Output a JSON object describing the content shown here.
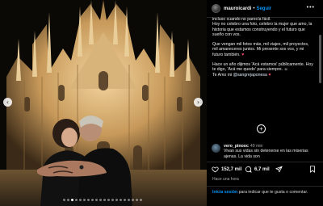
{
  "post": {
    "username": "mauroicardi",
    "separator": "•",
    "follow_label": "Seguir",
    "more_icon": "more-horizontal-icon"
  },
  "caption": {
    "lines": [
      "incluso cuando no parecía fácil.",
      "Hoy no celebro una foto, celebro la mujer que amo, la historia que estamos construyendo y el futuro que sueño con vos.",
      "Que vengan mil fotos más, mil viajes, mil proyectos, mil amaneceres juntos. Mi presente sos vos, y mi futuro también.",
      "Hace un año dijimos 'Acá estamos' públicamente. Hoy te digo, 'Acá me quedo' para siempre.",
      "Te Amo mi",
      "@sangrejaponesa"
    ],
    "heart_emoji": "♥",
    "smile_emoji": "☺"
  },
  "comment": {
    "username": "vero_pinooc",
    "time": "49 min",
    "text": "Vivan sus vidas sin detenerse en las miserias ajenas. La vida son"
  },
  "actions": {
    "likes": "152,7 mil",
    "comments": "6,7 mil",
    "like_icon": "heart-icon",
    "comment_icon": "comment-icon",
    "share_icon": "send-icon",
    "save_icon": "bookmark-icon"
  },
  "time_ago": "Hace una hora",
  "login_prompt": {
    "link": "Inicia sesión",
    "text": " para indicar que te gusta o comentar."
  },
  "carousel": {
    "total": 20,
    "active_index": 2,
    "prev_icon": "‹",
    "next_icon": "›"
  },
  "expand_icon": "+",
  "colors": {
    "accent": "#0095f6",
    "background": "#000000",
    "cathedral": "#e2c08a"
  }
}
